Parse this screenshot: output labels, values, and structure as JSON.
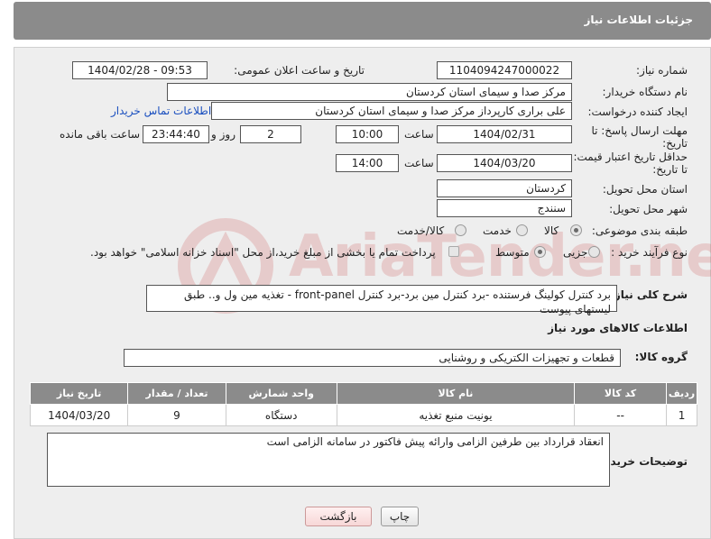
{
  "header": {
    "title": "جزئیات اطلاعات نیاز"
  },
  "fields": {
    "need_number_label": "شماره نیاز:",
    "need_number": "1104094247000022",
    "announce_label": "تاریخ و ساعت اعلان عمومی:",
    "announce_value": "1404/02/28 - 09:53",
    "buyer_org_label": "نام دستگاه خریدار:",
    "buyer_org": "مرکز صدا و سیمای استان کردستان",
    "creator_label": "ایجاد کننده درخواست:",
    "creator": "علی براری کارپرداز مرکز صدا و سیمای استان کردستان",
    "contact_link": "اطلاعات تماس خریدار",
    "deadline_label": "مهلت ارسال پاسخ: تا تاریخ:",
    "deadline_date": "1404/02/31",
    "time_label": "ساعت",
    "deadline_time": "10:00",
    "days_value": "2",
    "days_label": "روز و",
    "remaining_time": "23:44:40",
    "remaining_label": "ساعت باقی مانده",
    "validity_label": "حداقل تاریخ اعتبار قیمت: تا تاریخ:",
    "validity_date": "1404/03/20",
    "validity_time_label": "ساعت",
    "validity_time": "14:00",
    "province_label": "استان محل تحویل:",
    "province": "کردستان",
    "city_label": "شهر محل تحویل:",
    "city": "سنندج",
    "category_label": "طبقه بندی موضوعی:",
    "category_options": [
      "کالا",
      "خدمت",
      "کالا/خدمت"
    ],
    "process_label": "نوع فرآیند خرید :",
    "process_options": [
      "جزیی",
      "متوسط"
    ],
    "payment_note": "پرداخت تمام یا بخشی از مبلغ خرید،از محل \"اسناد خزانه اسلامی\" خواهد بود.",
    "description_label": "شرح کلی نیاز:",
    "description": "برد کنترل کولینگ فرستنده -برد کنترل مین برد-برد کنترل front-panel - تغذیه مین ول و.. طبق لیستهای پیوست",
    "goods_info_title": "اطلاعات کالاهای مورد نیاز",
    "goods_group_label": "گروه کالا:",
    "goods_group": "قطعات و تجهیزات الکتریکی و روشنایی",
    "buyer_notes_label": "توضیحات خریدار:",
    "buyer_notes": "انعقاد قرارداد بین طرفین الزامی وارائه پیش فاکتور در سامانه الزامی است"
  },
  "table": {
    "headers": [
      "ردیف",
      "کد کالا",
      "نام کالا",
      "واحد شمارش",
      "تعداد / مقدار",
      "تاریخ نیاز"
    ],
    "rows": [
      [
        "1",
        "--",
        "یونیت منبع تغذیه",
        "دستگاه",
        "9",
        "1404/03/20"
      ]
    ]
  },
  "buttons": {
    "print": "چاپ",
    "back": "بازگشت"
  },
  "watermark": {
    "text": "AriaTender.neT"
  }
}
